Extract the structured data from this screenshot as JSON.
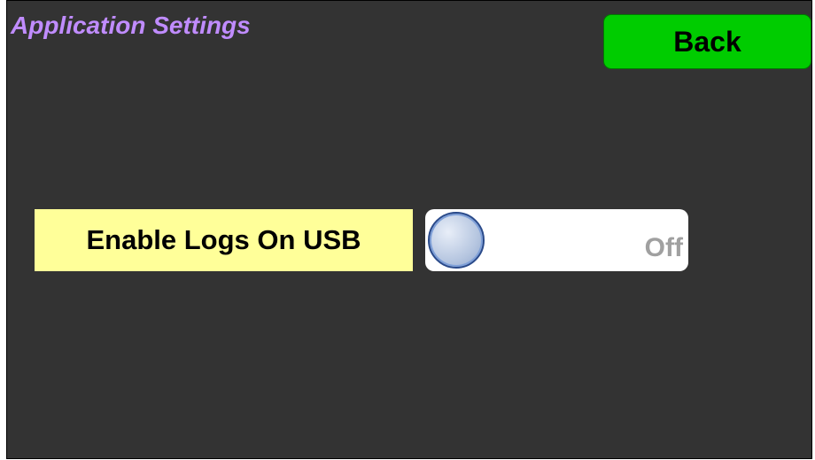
{
  "header": {
    "title": "Application Settings",
    "back_label": "Back"
  },
  "settings": {
    "enable_logs_usb": {
      "label": "Enable Logs On USB",
      "state_text": "Off",
      "enabled": false
    }
  },
  "colors": {
    "background": "#333333",
    "title": "#c08cff",
    "back_button": "#00cc00",
    "label_background": "#ffff99",
    "toggle_background": "#ffffff",
    "toggle_text": "#a0a0a0"
  }
}
